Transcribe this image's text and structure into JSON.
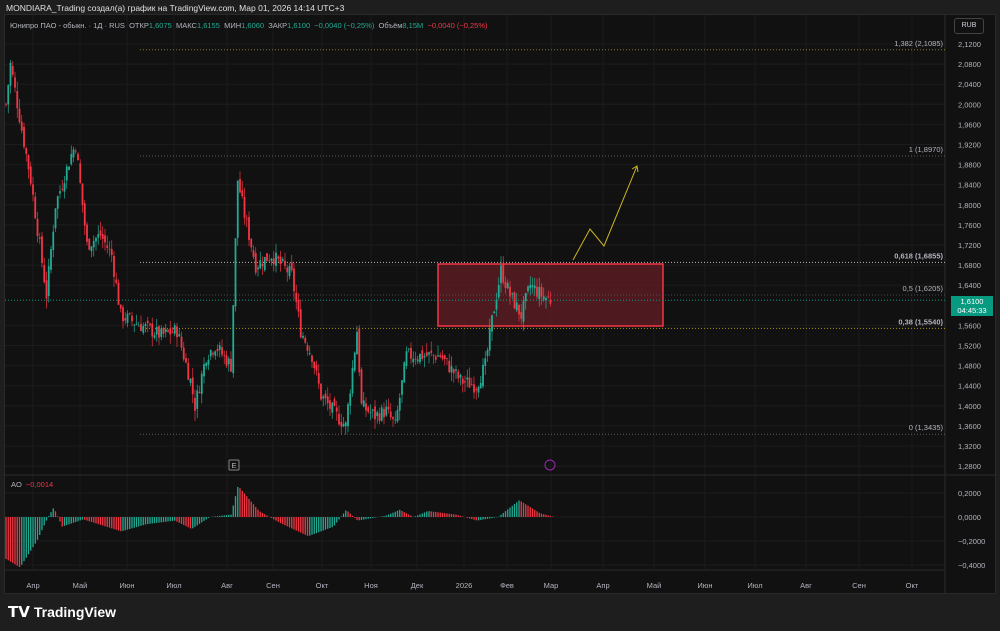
{
  "header": {
    "title": "MONDIARA_Trading создал(а) график на TradingView.com, Мар 01, 2026 14:14 UTC+3"
  },
  "legend": {
    "symbol": "Юнипро ПАО - обыкн. · 1Д · RUS",
    "open_label": "ОТКР",
    "open": "1,6075",
    "high_label": "МАКС",
    "high": "1,6155",
    "low_label": "МИН",
    "low": "1,6060",
    "close_label": "ЗАКР",
    "close": "1,6100",
    "change": "−0,0040 (−0,25%)",
    "volume_label": "Объём",
    "volume": "8,15M",
    "vol_change": "−0,0040 (−0,25%)"
  },
  "currency": "RUB",
  "price_axis": [
    "2,1200",
    "2,0800",
    "2,0400",
    "2,0000",
    "1,9600",
    "1,9200",
    "1,8800",
    "1,8400",
    "1,8000",
    "1,7600",
    "1,7200",
    "1,6800",
    "1,6400",
    "1,5600",
    "1,5200",
    "1,4800",
    "1,4400",
    "1,4000",
    "1,3600",
    "1,3200",
    "1,2800"
  ],
  "price_levels": [
    2.12,
    2.08,
    2.04,
    2.0,
    1.96,
    1.92,
    1.88,
    1.84,
    1.8,
    1.76,
    1.72,
    1.68,
    1.64,
    1.56,
    1.52,
    1.48,
    1.44,
    1.4,
    1.36,
    1.32,
    1.28
  ],
  "last_price": {
    "value": "1,6100",
    "countdown": "04:45:33",
    "color": "#089981"
  },
  "fib": [
    {
      "label": "1,382 (2,1085)",
      "price": 2.1085,
      "color": "#b5a642"
    },
    {
      "label": "1 (1,8970)",
      "price": 1.897,
      "color": "#787b86"
    },
    {
      "label": "0,618 (1,6855)",
      "price": 1.6855,
      "color": "#ffffff"
    },
    {
      "label": "0,5 (1,6205)",
      "price": 1.6205,
      "color": "#5d606b"
    },
    {
      "label": "0,38 (1,5540)",
      "price": 1.554,
      "color": "#f5d000"
    },
    {
      "label": "0 (1,3435)",
      "price": 1.3435,
      "color": "#787b86"
    }
  ],
  "ao": {
    "label": "AO",
    "value": "−0,0014",
    "axis": [
      "0,2000",
      "0,0000",
      "−0,2000",
      "−0,4000"
    ],
    "axis_values": [
      0.2,
      0,
      -0.2,
      -0.4
    ]
  },
  "time_axis": [
    "Апр",
    "Май",
    "Июн",
    "Июл",
    "Авг",
    "Сен",
    "Окт",
    "Ноя",
    "Дек",
    "2026",
    "Фев",
    "Мар",
    "Апр",
    "Май",
    "Июн",
    "Июл",
    "Авг",
    "Сен",
    "Окт"
  ],
  "price_path": [
    [
      0,
      2.0
    ],
    [
      2,
      2.08
    ],
    [
      7,
      1.95
    ],
    [
      11,
      1.85
    ],
    [
      18,
      1.62
    ],
    [
      22,
      1.8
    ],
    [
      29,
      1.9
    ],
    [
      31,
      1.92
    ],
    [
      36,
      1.72
    ],
    [
      42,
      1.74
    ],
    [
      47,
      1.7
    ],
    [
      51,
      1.58
    ],
    [
      60,
      1.56
    ],
    [
      69,
      1.54
    ],
    [
      76,
      1.55
    ],
    [
      82,
      1.45
    ],
    [
      84,
      1.4
    ],
    [
      89,
      1.5
    ],
    [
      93,
      1.52
    ],
    [
      100,
      1.48
    ],
    [
      103,
      1.85
    ],
    [
      106,
      1.78
    ],
    [
      111,
      1.68
    ],
    [
      118,
      1.7
    ],
    [
      127,
      1.66
    ],
    [
      131,
      1.55
    ],
    [
      136,
      1.5
    ],
    [
      140,
      1.42
    ],
    [
      147,
      1.38
    ],
    [
      151,
      1.36
    ],
    [
      156,
      1.55
    ],
    [
      158,
      1.4
    ],
    [
      164,
      1.38
    ],
    [
      169,
      1.39
    ],
    [
      173,
      1.36
    ],
    [
      178,
      1.5
    ],
    [
      184,
      1.5
    ],
    [
      193,
      1.5
    ],
    [
      202,
      1.45
    ],
    [
      209,
      1.44
    ],
    [
      213,
      1.48
    ],
    [
      216,
      1.57
    ],
    [
      220,
      1.67
    ],
    [
      224,
      1.62
    ],
    [
      229,
      1.58
    ],
    [
      233,
      1.64
    ],
    [
      238,
      1.62
    ],
    [
      242,
      1.61
    ]
  ],
  "ao_path": [
    [
      0,
      -0.35
    ],
    [
      10,
      -0.42
    ],
    [
      22,
      -0.2
    ],
    [
      30,
      0.0
    ],
    [
      34,
      0.08
    ],
    [
      40,
      -0.08
    ],
    [
      55,
      -0.02
    ],
    [
      82,
      -0.12
    ],
    [
      100,
      -0.06
    ],
    [
      120,
      -0.03
    ],
    [
      132,
      -0.1
    ],
    [
      145,
      0.0
    ],
    [
      160,
      0.02
    ],
    [
      165,
      0.26
    ],
    [
      180,
      0.05
    ],
    [
      195,
      -0.05
    ],
    [
      215,
      -0.16
    ],
    [
      233,
      -0.08
    ],
    [
      242,
      0.06
    ],
    [
      250,
      -0.03
    ],
    [
      270,
      0.01
    ],
    [
      280,
      0.06
    ],
    [
      290,
      0.0
    ],
    [
      300,
      0.05
    ],
    [
      320,
      0.02
    ],
    [
      335,
      -0.03
    ],
    [
      350,
      0.0
    ],
    [
      365,
      0.14
    ],
    [
      380,
      0.03
    ],
    [
      390,
      0.0
    ]
  ],
  "colors": {
    "up": "#22ab94",
    "down": "#f23645",
    "zone_fill": "#5a1c22",
    "zone_border": "#f23645",
    "arrow": "#c9b520"
  },
  "brand": "TradingView"
}
